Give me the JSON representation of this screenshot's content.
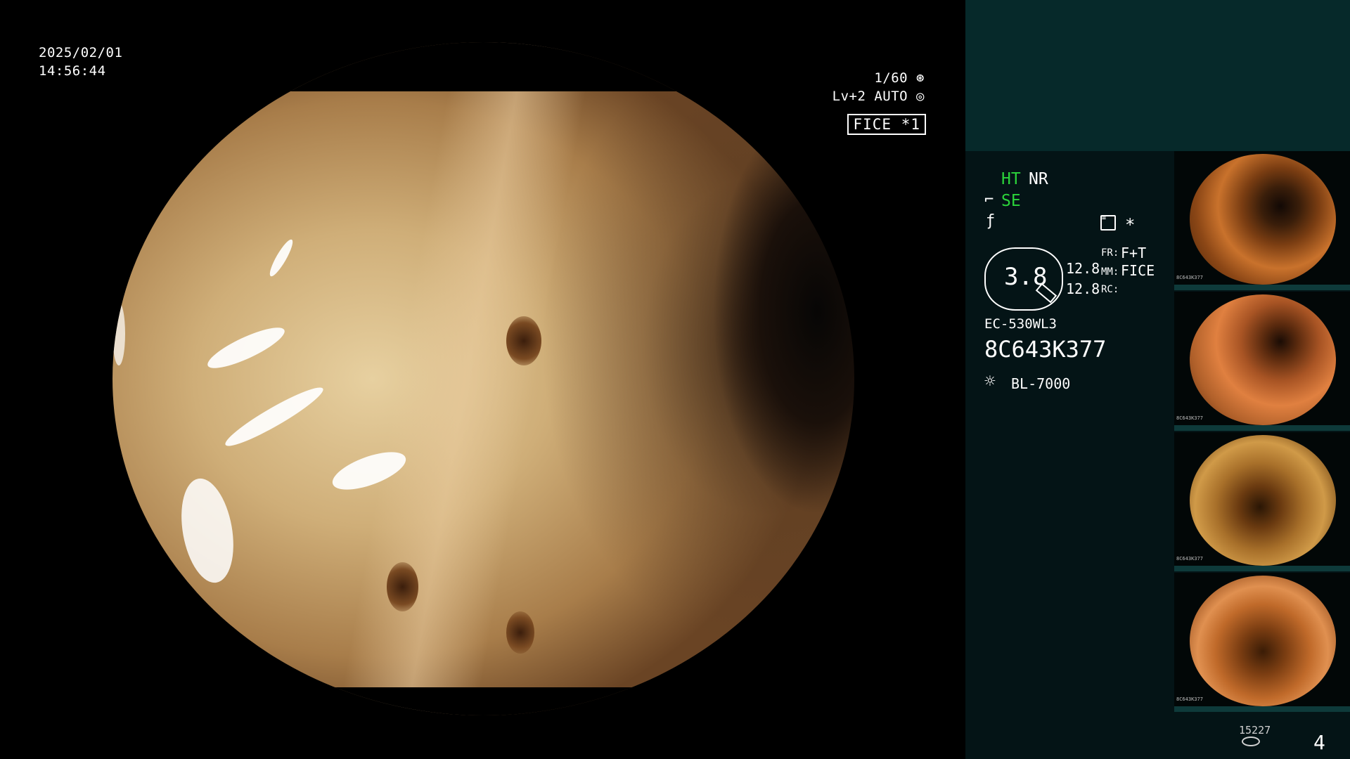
{
  "overlay": {
    "date": "2025/02/01",
    "time": "14:56:44",
    "shutter": "1/60",
    "level": "Lv+2 AUTO",
    "mode_badge": "FICE *1"
  },
  "info": {
    "ht": "HT",
    "nr": "NR",
    "se": "SE",
    "scope_value": "3.8",
    "value_a": "12.8",
    "value_b": "12.8",
    "fr_label": "FR:",
    "fr_value": "F+T",
    "mm_label": "MM:",
    "mm_value": "FICE",
    "rc_label": "RC:",
    "scope_model": "EC-530WL3",
    "serial": "8C643K377",
    "light_source": "BL-7000",
    "asterisk": "*"
  },
  "thumbnails": [
    {
      "id": "thumb-1",
      "serial": "8C643K377"
    },
    {
      "id": "thumb-2",
      "serial": "8C643K377"
    },
    {
      "id": "thumb-3",
      "serial": "8C643K377"
    },
    {
      "id": "thumb-4",
      "serial": "8C643K377"
    }
  ],
  "footer": {
    "count": "15227",
    "page": "4"
  },
  "colors": {
    "panel_bg": "#041416",
    "panel_top": "#06292a",
    "accent_green": "#2bd33a"
  }
}
